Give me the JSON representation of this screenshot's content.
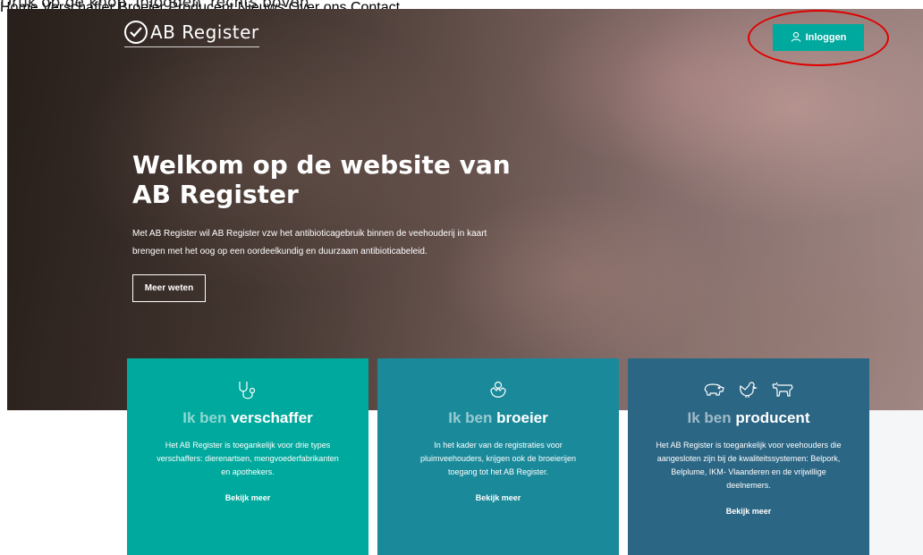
{
  "instruction": "Druk op de knop 'Inloggen' rechts boven",
  "brand": {
    "name": "AB Register"
  },
  "nav": {
    "items": [
      "Home",
      "Verschaffer",
      "Broeier",
      "Producent",
      "Nieuws",
      "Over ons",
      "Contact"
    ],
    "login_label": "Inloggen"
  },
  "hero": {
    "title_lines": [
      "Welkom op de website van",
      "AB Register"
    ],
    "text_lines": [
      "Met AB Register wil AB Register vzw het antibioticagebruik binnen de veehouderij in kaart",
      "brengen met het oog op een oordeelkundig en duurzaam antibioticabeleid."
    ],
    "button_label": "Meer weten"
  },
  "cards": [
    {
      "prefix": "Ik ben",
      "role": "verschaffer",
      "icons": [
        "stethoscope-icon"
      ],
      "lines": [
        "Het AB Register is toegankelijk voor drie types",
        "verschaffers: dierenartsen, mengvoederfabrikanten",
        "en apothekers."
      ],
      "link": "Bekijk meer",
      "color": "#00a99d"
    },
    {
      "prefix": "Ik ben",
      "role": "broeier",
      "icons": [
        "hatching-egg-icon"
      ],
      "lines": [
        "In het kader van de registraties voor",
        "pluimveehouders, krijgen ook de broeierijen",
        "toegang tot het AB Register."
      ],
      "link": "Bekijk meer",
      "color": "#1a8a9b"
    },
    {
      "prefix": "Ik ben",
      "role": "producent",
      "icons": [
        "pig-icon",
        "chicken-icon",
        "cow-icon"
      ],
      "lines": [
        "Het AB Register is toegankelijk voor veehouders die",
        "aangesloten zijn bij de kwaliteitssystemen: Belpork,",
        "Belplume, IKM- Vlaanderen en de vrijwillige",
        "deelnemers."
      ],
      "link": "Bekijk meer",
      "color": "#2b6684"
    }
  ],
  "colors": {
    "teal": "#00a99d",
    "highlight": "#e00000"
  }
}
